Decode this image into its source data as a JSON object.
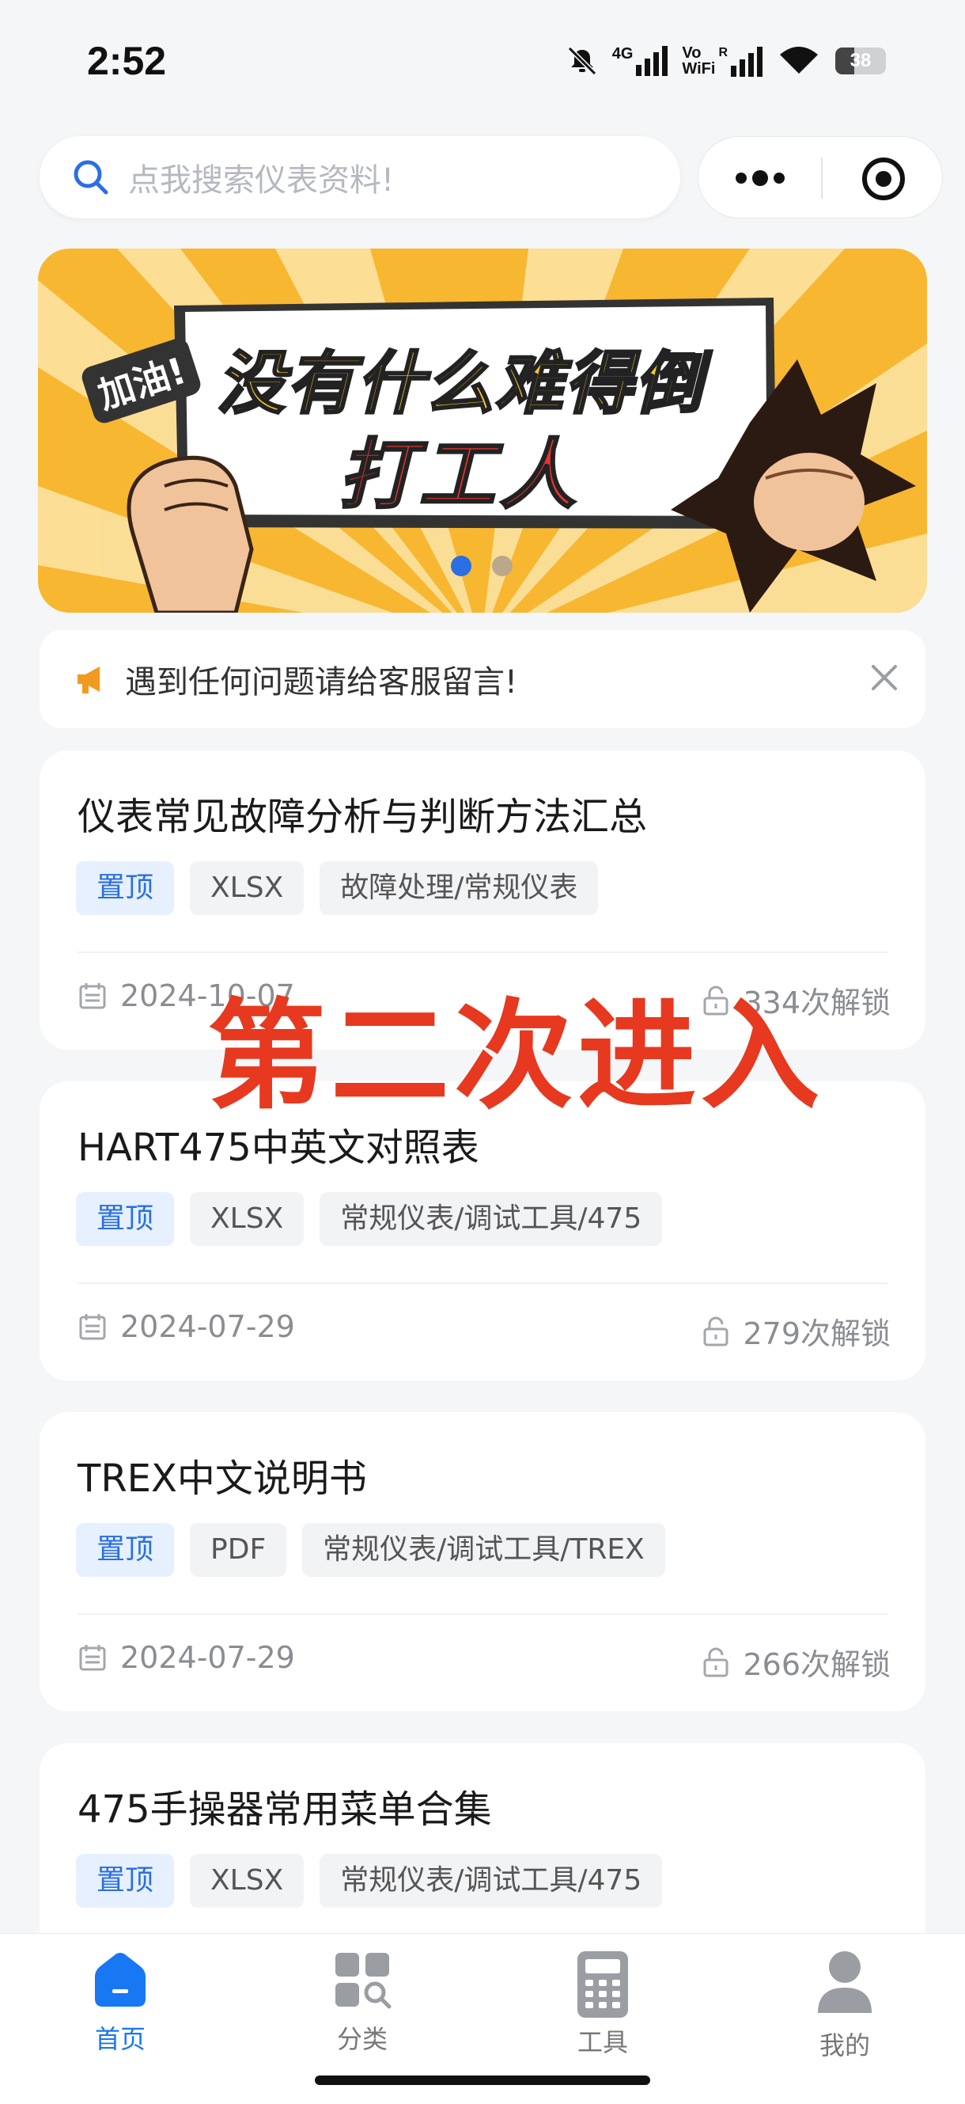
{
  "status_bar": {
    "time": "2:52",
    "network1": "4G",
    "network2_top": "Vo",
    "network2_bottom": "WiFi",
    "roaming": "R",
    "battery": "38",
    "battery_level": 0.38
  },
  "header": {
    "search_placeholder": "点我搜索仪表资料!",
    "more_icon": "more-dots-icon",
    "target_icon": "target-icon"
  },
  "banner": {
    "badge": "加油!",
    "line1": "没有什么难得倒",
    "line2": "打工人",
    "active_dot": 0,
    "dot_count": 2
  },
  "notice": {
    "icon": "megaphone-icon",
    "text": "遇到任何问题请给客服留言!"
  },
  "overlay_text": "第二次进入",
  "cards": [
    {
      "title": "仪表常见故障分析与判断方法汇总",
      "tags": [
        "置顶",
        "XLSX",
        "故障处理/常规仪表"
      ],
      "date": "2024-10-07",
      "unlocks": "334次解锁"
    },
    {
      "title": "HART475中英文对照表",
      "tags": [
        "置顶",
        "XLSX",
        "常规仪表/调试工具/475"
      ],
      "date": "2024-07-29",
      "unlocks": "279次解锁"
    },
    {
      "title": "TREX中文说明书",
      "tags": [
        "置顶",
        "PDF",
        "常规仪表/调试工具/TREX"
      ],
      "date": "2024-07-29",
      "unlocks": "266次解锁"
    },
    {
      "title": "475手操器常用菜单合集",
      "tags": [
        "置顶",
        "XLSX",
        "常规仪表/调试工具/475"
      ],
      "date": "",
      "unlocks": ""
    }
  ],
  "tabbar": {
    "items": [
      {
        "label": "首页",
        "icon": "home-icon",
        "active": true
      },
      {
        "label": "分类",
        "icon": "category-icon",
        "active": false
      },
      {
        "label": "工具",
        "icon": "calculator-icon",
        "active": false
      },
      {
        "label": "我的",
        "icon": "user-icon",
        "active": false
      }
    ],
    "active_color": "#1877f2"
  }
}
